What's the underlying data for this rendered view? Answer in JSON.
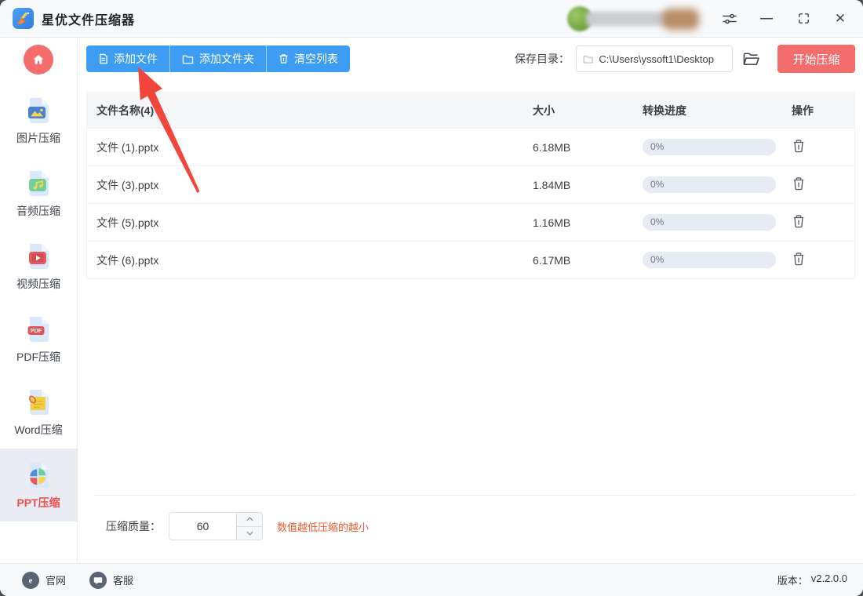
{
  "titlebar": {
    "app_title": "星优文件压缩器",
    "minimize_glyph": "—",
    "close_glyph": "✕"
  },
  "sidebar": {
    "items": [
      {
        "id": "image",
        "label": "图片压缩",
        "active": false
      },
      {
        "id": "audio",
        "label": "音频压缩",
        "active": false
      },
      {
        "id": "video",
        "label": "视频压缩",
        "active": false
      },
      {
        "id": "pdf",
        "label": "PDF压缩",
        "active": false
      },
      {
        "id": "word",
        "label": "Word压缩",
        "active": false
      },
      {
        "id": "ppt",
        "label": "PPT压缩",
        "active": true
      }
    ]
  },
  "toolbar": {
    "add_file_label": "添加文件",
    "add_folder_label": "添加文件夹",
    "clear_list_label": "清空列表",
    "save_dir_label": "保存目录：",
    "save_dir_value": "C:\\Users\\yssoft1\\Desktop",
    "start_label": "开始压缩"
  },
  "file_table": {
    "headers": {
      "name": "文件名称(4)",
      "size": "大小",
      "progress": "转换进度",
      "action": "操作"
    },
    "rows": [
      {
        "name": "文件 (1).pptx",
        "size": "6.18MB",
        "progress": "0%"
      },
      {
        "name": "文件 (3).pptx",
        "size": "1.84MB",
        "progress": "0%"
      },
      {
        "name": "文件 (5).pptx",
        "size": "1.16MB",
        "progress": "0%"
      },
      {
        "name": "文件 (6).pptx",
        "size": "6.17MB",
        "progress": "0%"
      }
    ]
  },
  "quality": {
    "label": "压缩质量：",
    "value": "60",
    "hint": "数值越低压缩的越小"
  },
  "footer": {
    "official_label": "官网",
    "support_label": "客服",
    "version_label": "版本：",
    "version_value": "v2.2.0.0"
  },
  "icons": {
    "settings": "sliders-icon",
    "maximize": "corner-brackets",
    "home": "house-glyph",
    "official_site": "e-globe",
    "support": "chat-bubble"
  },
  "colors": {
    "primary_blue": "#3d9df3",
    "start_red": "#f56c6c",
    "active_text_red": "#f04f4f",
    "hint_orange": "#f4582e",
    "progress_pill": "#e7ebf4",
    "annotation_arrow": "#f0463c"
  }
}
